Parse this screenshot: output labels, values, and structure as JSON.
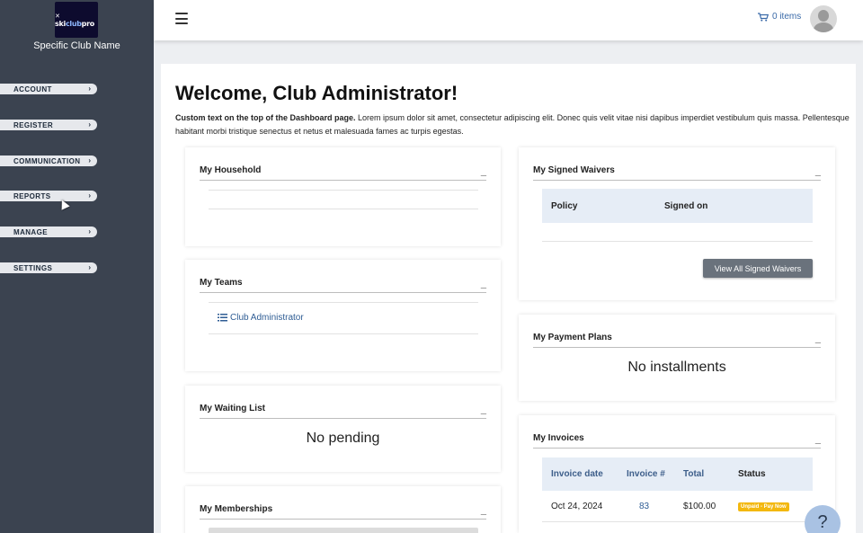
{
  "sidebar": {
    "logo_text_a": "ski",
    "logo_text_b": "club",
    "logo_text_c": "pro",
    "club_name": "Specific Club Name",
    "items": [
      {
        "label": "ACCOUNT"
      },
      {
        "label": "REGISTER"
      },
      {
        "label": "COMMUNICATION"
      },
      {
        "label": "REPORTS"
      },
      {
        "label": "MANAGE"
      },
      {
        "label": "SETTINGS"
      }
    ]
  },
  "topbar": {
    "cart_label": "0 items"
  },
  "main": {
    "welcome": "Welcome, Club Administrator!",
    "intro_bold": "Custom text on the top of the Dashboard page.",
    "intro_text": "  Lorem ipsum dolor sit amet, consectetur adipiscing elit. Donec quis velit vitae nisi dapibus imperdiet vestibulum quis massa. Pellentesque habitant morbi tristique senectus et netus et malesuada fames ac turpis egestas."
  },
  "cards": {
    "household": {
      "title": "My Household",
      "collapse": "_"
    },
    "teams": {
      "title": "My Teams",
      "collapse": "_",
      "link": "Club Administrator"
    },
    "waiting": {
      "title": "My Waiting List",
      "collapse": "_",
      "message": "No pending"
    },
    "memberships": {
      "title": "My Memberships",
      "collapse": "_"
    },
    "waivers": {
      "title": "My Signed Waivers",
      "collapse": "_",
      "columns": [
        "Policy",
        "Signed on"
      ],
      "button": "View All Signed Waivers"
    },
    "payment_plans": {
      "title": "My Payment Plans",
      "collapse": "_",
      "message": "No installments"
    },
    "invoices": {
      "title": "My Invoices",
      "collapse": "_",
      "columns": [
        "Invoice date",
        "Invoice #",
        "Total",
        "Status"
      ],
      "rows": [
        {
          "date": "Oct 24, 2024",
          "number": "83",
          "total": "$100.00",
          "status": "Unpaid - Pay Now"
        }
      ]
    }
  },
  "help": {
    "label": "?"
  },
  "colors": {
    "sidebar_bg": "#3b4350",
    "link": "#2f5d94",
    "badge": "#f3b80f",
    "table_header": "#e6edf6"
  }
}
